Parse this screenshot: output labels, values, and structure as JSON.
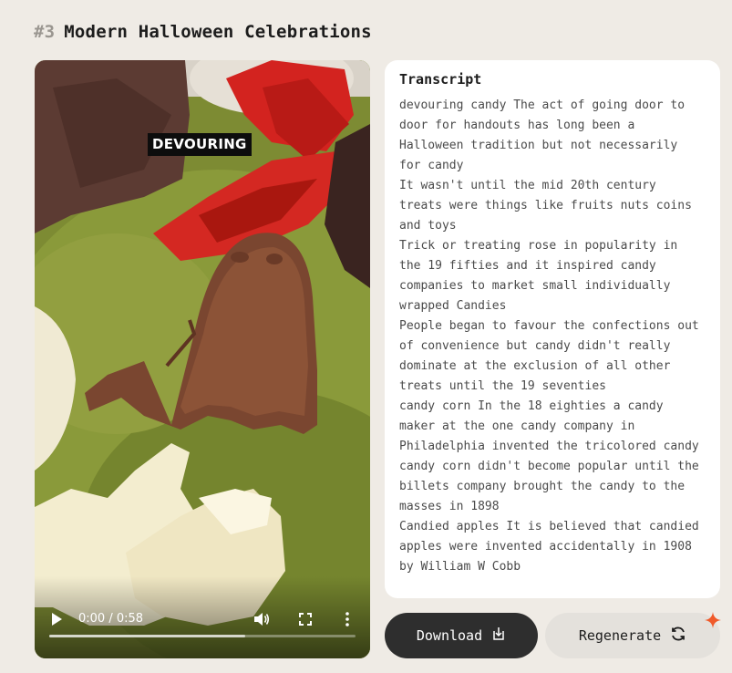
{
  "heading": {
    "number": "#3",
    "title": "Modern Halloween Celebrations"
  },
  "video": {
    "caption": "DEVOURING",
    "time": "0:00 / 0:58",
    "buffered_fraction": 0.64
  },
  "transcript": {
    "title": "Transcript",
    "text": "devouring candy The act of going door to door for handouts has long been a Halloween tradition but not necessarily for candy\nIt wasn't until the mid 20th century treats were things like fruits nuts coins and toys\nTrick or treating rose in popularity in the 19 fifties and it inspired candy companies to market small individually wrapped Candies\nPeople began to favour the confections out of convenience but candy didn't really dominate at the exclusion of all other treats until the 19 seventies\ncandy corn In the 18 eighties a candy maker at the one candy company in Philadelphia invented the tricolored candy candy corn didn't become popular until the billets company brought the candy to the masses in 1898\nCandied apples It is believed that candied apples were invented accidentally in 1908 by William W Cobb"
  },
  "buttons": {
    "download_label": "Download",
    "regenerate_label": "Regenerate"
  },
  "colors": {
    "background": "#efebe5",
    "download_bg": "#2e2e2e",
    "regenerate_bg": "#e4e1dc",
    "sparkle": "#f05a2a"
  },
  "icons": {
    "download": "download-tray-icon",
    "regenerate": "refresh-icon",
    "sparkle": "sparkle-icon",
    "play": "play-icon",
    "volume": "volume-icon",
    "fullscreen": "fullscreen-icon",
    "more": "more-vertical-icon"
  }
}
